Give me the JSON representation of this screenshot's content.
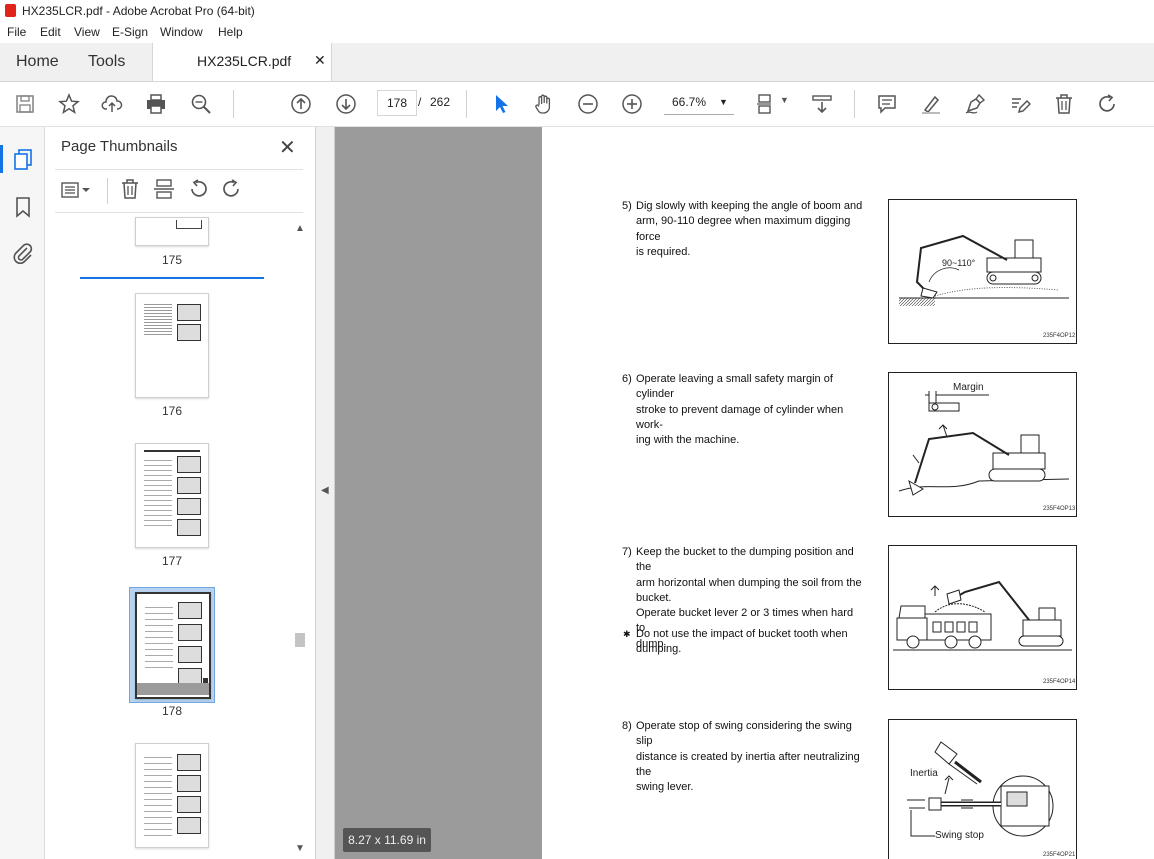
{
  "window": {
    "title": "HX235LCR.pdf - Adobe Acrobat Pro (64-bit)"
  },
  "menu": [
    "File",
    "Edit",
    "View",
    "E-Sign",
    "Window",
    "Help"
  ],
  "tabs": {
    "home": "Home",
    "tools": "Tools",
    "document": "HX235LCR.pdf"
  },
  "navigation": {
    "current_page": "178",
    "separator": "/",
    "total_pages": "262",
    "zoom": "66.7%"
  },
  "panel": {
    "title": "Page Thumbnails",
    "thumbnails": [
      {
        "label": "175",
        "selected": false
      },
      {
        "label": "176",
        "selected": false
      },
      {
        "label": "177",
        "selected": false
      },
      {
        "label": "178",
        "selected": true
      },
      {
        "label": ""
      }
    ]
  },
  "document": {
    "steps": [
      {
        "num": "5)",
        "lines": [
          "Dig slowly with keeping the angle of boom and",
          "arm, 90-110 degree when maximum digging force",
          "is required."
        ],
        "figure_label": "90~110°",
        "figure_code": "235F4OP12"
      },
      {
        "num": "6)",
        "lines": [
          "Operate leaving a small safety margin of cylinder",
          "stroke to prevent damage of cylinder when work-",
          "ing with the machine."
        ],
        "figure_label": "Margin",
        "figure_code": "235F4OP13"
      },
      {
        "num": "7)",
        "lines": [
          "Keep the bucket to the dumping position and the",
          "arm horizontal when dumping the soil from the",
          "bucket.",
          "Operate bucket lever 2 or 3 times when hard to",
          "dump."
        ],
        "note_mark": "✱",
        "note_lines": [
          "Do not use the impact of bucket tooth when",
          "dumping."
        ],
        "figure_code": "235F4OP14"
      },
      {
        "num": "8)",
        "lines": [
          "Operate stop of swing considering the swing slip",
          "distance is created by inertia after neutralizing the",
          "swing lever."
        ],
        "figure_label_1": "Inertia",
        "figure_label_2": "Swing stop",
        "figure_code": "235F4OP21"
      }
    ],
    "page_size": "8.27 x 11.69 in"
  },
  "icons": {
    "toolbar": [
      "save-icon",
      "star-icon",
      "upload-icon",
      "print-icon",
      "search-icon",
      "page-up-icon",
      "page-down-icon",
      "cursor-icon",
      "hand-icon",
      "zoom-out-icon",
      "zoom-in-icon",
      "fit-page-icon",
      "scroll-mode-icon",
      "comment-icon",
      "highlight-icon",
      "sign-icon",
      "edit-icon",
      "delete-icon",
      "redo-icon"
    ],
    "accent": "#1473e6"
  }
}
